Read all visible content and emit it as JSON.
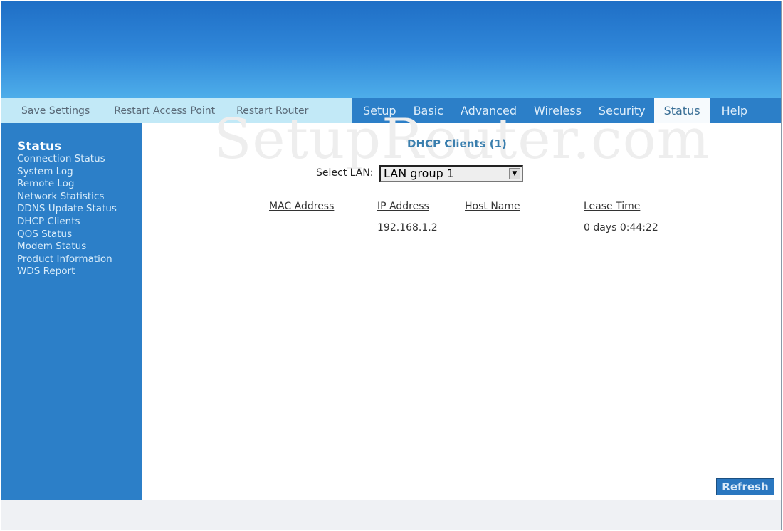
{
  "watermark": "SetupRouter.com",
  "actions": [
    "Save Settings",
    "Restart Access Point",
    "Restart Router"
  ],
  "tabs": [
    {
      "label": "Setup"
    },
    {
      "label": "Basic"
    },
    {
      "label": "Advanced"
    },
    {
      "label": "Wireless"
    },
    {
      "label": "Security"
    },
    {
      "label": "Status",
      "active": true
    },
    {
      "label": "Help"
    }
  ],
  "sidebar": {
    "heading": "Status",
    "items": [
      "Connection Status",
      "System Log",
      "Remote Log",
      "Network Statistics",
      "DDNS Update Status",
      "DHCP Clients",
      "QOS Status",
      "Modem Status",
      "Product Information",
      "WDS Report"
    ]
  },
  "main": {
    "title": "DHCP Clients (1)",
    "lan_label": "Select LAN:",
    "lan_value": "LAN group 1",
    "columns": [
      "MAC Address",
      "IP Address",
      "Host Name",
      "Lease Time"
    ],
    "rows": [
      {
        "mac": "",
        "ip": "192.168.1.2",
        "host": "",
        "lease": "0 days 0:44:22"
      }
    ],
    "refresh": "Refresh"
  },
  "colors": {
    "nav_blue": "#2c7fc8",
    "action_bar": "#c2e9f7",
    "title": "#3b7fae"
  }
}
